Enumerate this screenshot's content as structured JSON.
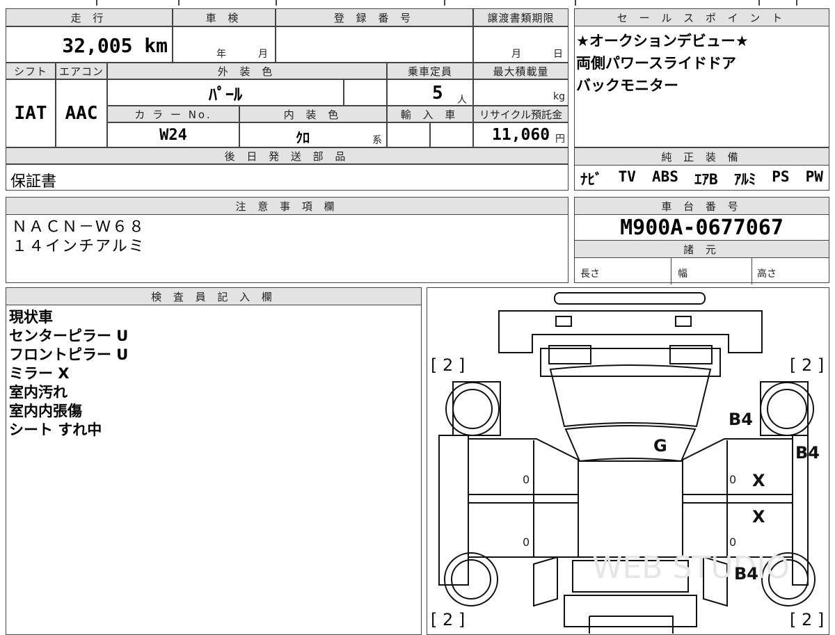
{
  "main_grid": {
    "mileage_header": "走 行",
    "mileage_value": "32,005 km",
    "inspection_header": "車 検",
    "inspection_year": "年",
    "inspection_month": "月",
    "registration_header": "登 録 番 号",
    "transfer_header": "譲渡書類期限",
    "transfer_month": "月",
    "transfer_day": "日",
    "shift_header": "シフト",
    "shift_value": "IAT",
    "ac_header": "エアコン",
    "ac_value": "AAC",
    "exterior_color_header": "外 装 色",
    "exterior_color_value": "ﾊﾟｰﾙ",
    "capacity_header": "乗車定員",
    "capacity_value": "5",
    "capacity_unit": "人",
    "max_load_header": "最大積載量",
    "max_load_unit": "kg",
    "color_no_header": "カ ラ ー No.",
    "color_no_value": "W24",
    "interior_color_header": "内 装 色",
    "interior_color_value": "ｸﾛ",
    "interior_color_suffix": "系",
    "import_header": "輸 入 車",
    "recycle_header": "リサイクル預託金",
    "recycle_value": "11,060",
    "recycle_unit": "円"
  },
  "later_shipping": {
    "header": "後 日 発 送 部 品",
    "value": "保証書"
  },
  "sales_points": {
    "header": "セ ー ル ス ポ イ ン ト",
    "lines": [
      "★オークションデビュー★",
      "両側パワースライドドア",
      "バックモニター"
    ]
  },
  "genuine_equipment": {
    "header": "純 正 装 備",
    "items": [
      "ﾅﾋﾞ",
      "TV",
      "ABS",
      "ｴｱB",
      "ｱﾙﾐ",
      "PS",
      "PW"
    ]
  },
  "notes": {
    "header": "注 意 事 項 欄",
    "lines": [
      "ＮＡＣＮ－Ｗ６８",
      "１４インチアルミ"
    ]
  },
  "chassis": {
    "header": "車 台 番 号",
    "value": "M900A-0677067"
  },
  "specs": {
    "header": "諸 元",
    "length_label": "長さ",
    "width_label": "幅",
    "height_label": "高さ"
  },
  "inspector": {
    "header": "検 査 員 記 入 欄",
    "lines": [
      "現状車",
      "センターピラー U",
      "フロントピラー U",
      "ミラー X",
      "室内汚れ",
      "室内内張傷",
      "シート すれ中"
    ]
  },
  "diagram": {
    "tire_mark_top_left": "[ 2 ]",
    "tire_mark_top_right": "[ 2 ]",
    "tire_mark_bottom_left": "[ 2 ]",
    "tire_mark_bottom_right": "[ 2 ]",
    "mark_roof": "G",
    "mark_front_right": "B4",
    "mark_right_pillar": "B4",
    "mark_rear_right": "B4",
    "mark_door_fr": "X",
    "mark_door_rr": "X",
    "zero_fl": "0",
    "zero_rl": "0",
    "zero_fr": "0",
    "zero_rr": "0",
    "watermark": "WEB STUDIO"
  }
}
